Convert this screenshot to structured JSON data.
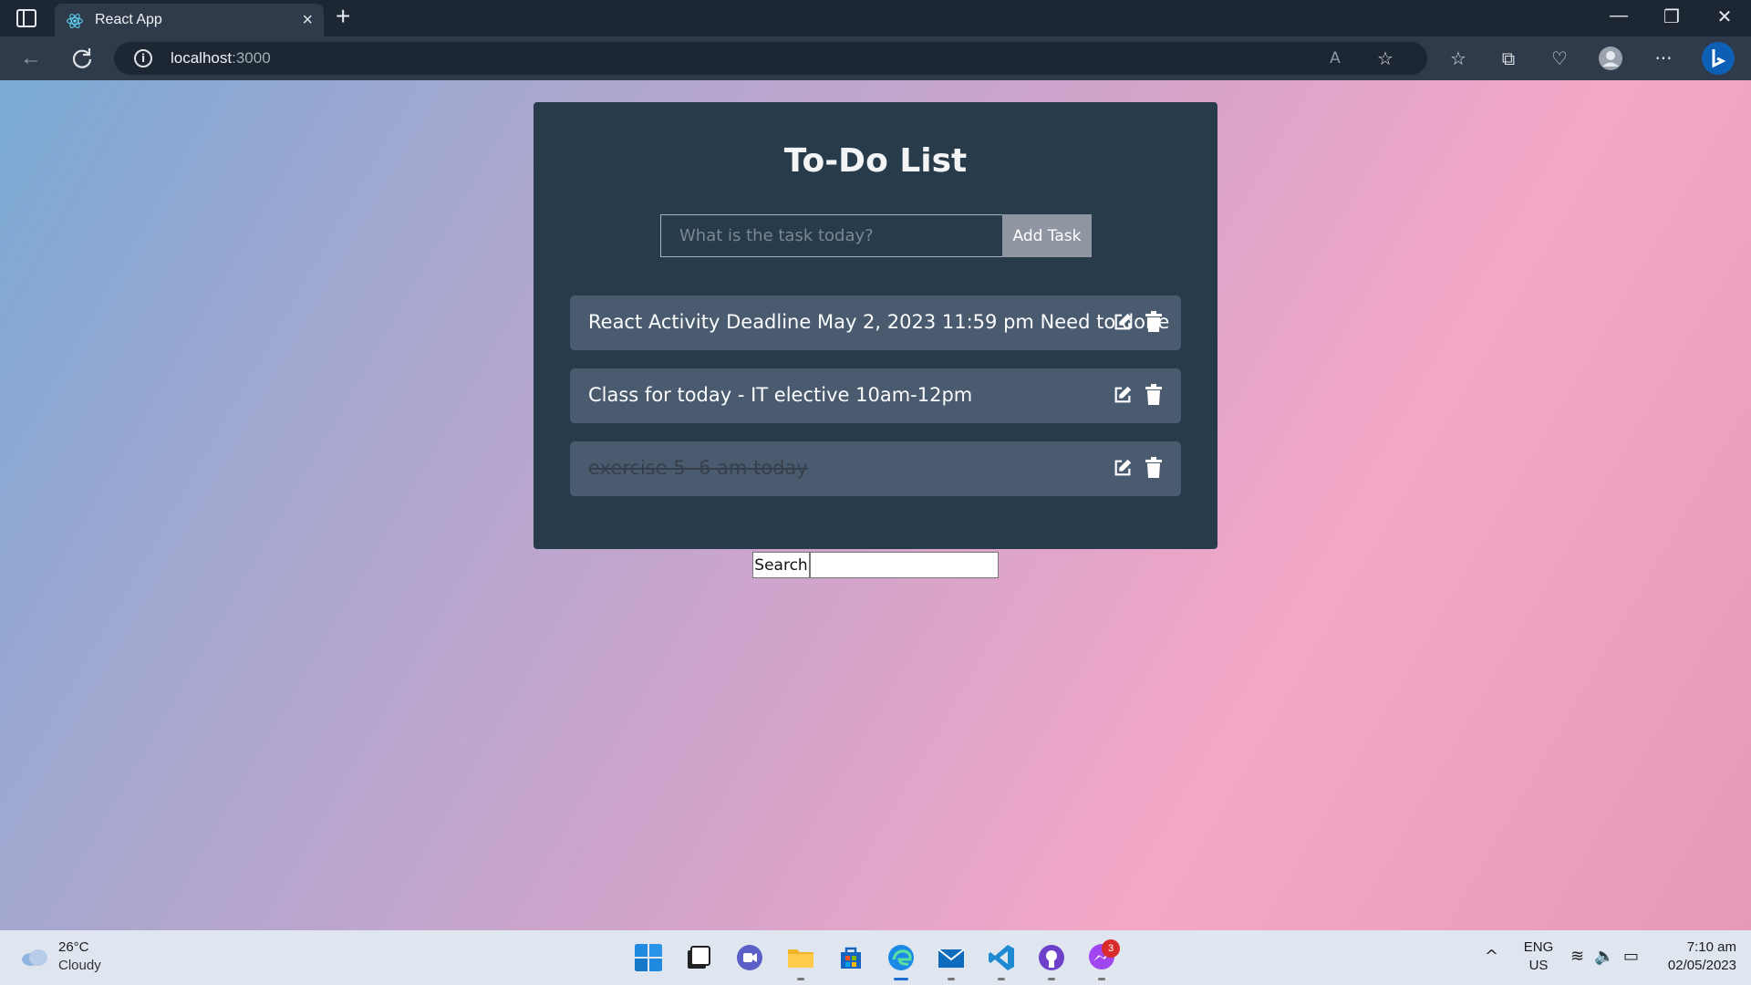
{
  "browser": {
    "tab_title": "React App",
    "tab_close": "×",
    "new_tab": "+",
    "url_host": "localhost",
    "url_port": ":3000",
    "window_controls": {
      "minimize": "—",
      "restore": "❐",
      "close": "✕"
    }
  },
  "app": {
    "title": "To-Do List",
    "input_placeholder": "What is the task today?",
    "add_button": "Add Task",
    "todos": [
      {
        "text": "React Activity Deadline May 2, 2023 11:59 pm Need to done",
        "completed": false
      },
      {
        "text": "Class for today - IT elective 10am-12pm",
        "completed": false
      },
      {
        "text": "exercise 5- 6 am today",
        "completed": true
      }
    ],
    "search_button": "Search"
  },
  "taskbar": {
    "weather_temp": "26°C",
    "weather_desc": "Cloudy",
    "messenger_badge": "3",
    "lang_top": "ENG",
    "lang_bottom": "US",
    "time": "7:10 am",
    "date": "02/05/2023"
  },
  "colors": {
    "card": "#273b4b",
    "todo_item": "#4a5b70",
    "add_button": "#8f96a2",
    "accent_edge": "#0c5fb5"
  }
}
